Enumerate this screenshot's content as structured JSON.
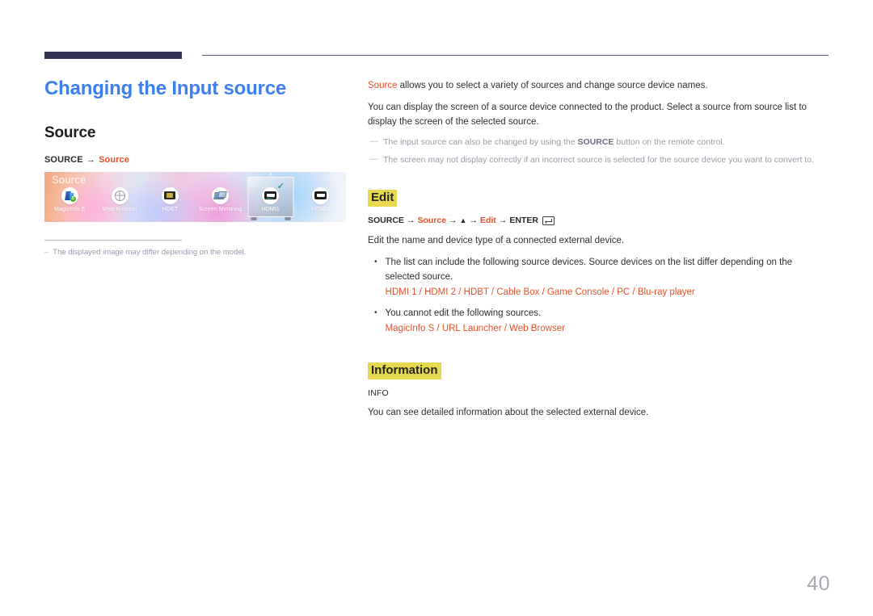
{
  "page": {
    "number": "40"
  },
  "header": {
    "rule": "decorative-rule"
  },
  "left": {
    "title": "Changing the Input source",
    "section_title": "Source",
    "breadcrumb": {
      "root": "SOURCE",
      "arrow": "→",
      "leaf": "Source"
    },
    "screenshot": {
      "label": "Source",
      "items": [
        {
          "name": "MagicInfo S",
          "icon": "magicinfo-icon",
          "selected": false
        },
        {
          "name": "Web Browser",
          "icon": "globe-icon",
          "selected": false
        },
        {
          "name": "HDBT",
          "icon": "hdbt-port-icon",
          "selected": false
        },
        {
          "name": "Screen Mirroring",
          "icon": "screen-mirroring-icon",
          "selected": false
        },
        {
          "name": "HDMI1",
          "icon": "hdmi-port-icon",
          "selected": true
        },
        {
          "name": "HDMI2",
          "icon": "hdmi-port-icon",
          "selected": false
        }
      ],
      "selected_check": "✓",
      "caret": "∧"
    },
    "note": {
      "dash": "–",
      "text": "The displayed image may differ depending on the model."
    }
  },
  "right": {
    "intro": {
      "accent": "Source",
      "rest": " allows you to select a variety of sources and change source device names."
    },
    "paragraph": "You can display the screen of a source device connected to the product. Select a source from source list to display the screen of the selected source.",
    "notes": [
      {
        "dash": "—",
        "pre": "The input source can also be changed by using the ",
        "bold": "SOURCE",
        "post": " button on the remote control."
      },
      {
        "dash": "—",
        "pre": "The screen may not display correctly if an incorrect source is selected for the source device you want to convert to.",
        "bold": "",
        "post": ""
      }
    ],
    "edit": {
      "heading": "Edit",
      "crumb": {
        "root": "SOURCE",
        "arrow1": "→",
        "source": "Source",
        "arrow2": "→",
        "up": "▲",
        "arrow3": "→",
        "edit": "Edit",
        "arrow4": "→",
        "enter": "ENTER"
      },
      "description": "Edit the name and device type of a connected external device.",
      "bullets": [
        {
          "marker": "•",
          "text": "The list can include the following source devices. Source devices on the list differ depending on the selected source.",
          "devices": "HDMI 1 / HDMI 2 / HDBT / Cable Box / Game Console / PC / Blu-ray player"
        },
        {
          "marker": "•",
          "text": "You cannot edit the following sources.",
          "devices": "MagicInfo S / URL Launcher / Web Browser"
        }
      ]
    },
    "information": {
      "heading": "Information",
      "sub_label": "INFO",
      "description": "You can see detailed information about the selected external device."
    }
  },
  "colors": {
    "title_blue": "#3d7ff0",
    "accent_orange": "#e8502a",
    "highlight_yellow": "#e8d84d",
    "rule_navy": "#333355",
    "note_gray": "#9a9aae",
    "page_num_gray": "#a9a9b4"
  }
}
